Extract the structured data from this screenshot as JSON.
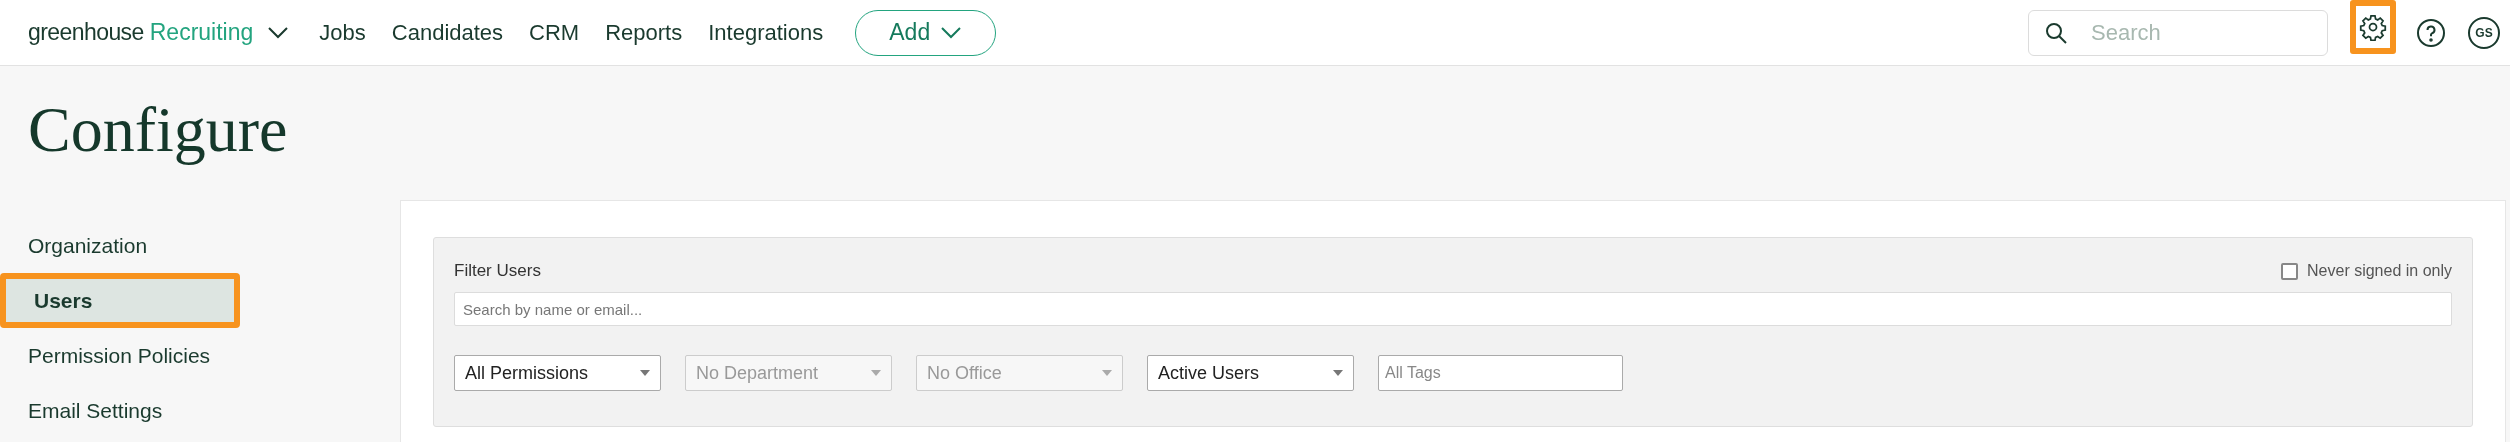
{
  "top_bar": {
    "logo": {
      "wordmark": "greenhouse",
      "product": "Recruiting"
    },
    "nav": [
      "Jobs",
      "Candidates",
      "CRM",
      "Reports",
      "Integrations"
    ],
    "add_button": "Add",
    "search": {
      "placeholder": "Search"
    },
    "settings": {
      "highlighted": true
    },
    "avatar": "GS"
  },
  "page_title": "Configure",
  "sidebar": {
    "items": [
      {
        "label": "Organization",
        "selected": false,
        "highlighted": false
      },
      {
        "label": "Users",
        "selected": true,
        "highlighted": true
      },
      {
        "label": "Permission Policies",
        "selected": false,
        "highlighted": false
      },
      {
        "label": "Email Settings",
        "selected": false,
        "highlighted": false
      }
    ]
  },
  "filter": {
    "title": "Filter Users",
    "never_signed_in": {
      "label": "Never signed in only",
      "checked": false
    },
    "search": {
      "placeholder": "Search by name or email..."
    },
    "controls": [
      {
        "kind": "select",
        "value": "All Permissions",
        "disabled": false
      },
      {
        "kind": "select",
        "value": "No Department",
        "disabled": true
      },
      {
        "kind": "select",
        "value": "No Office",
        "disabled": true
      },
      {
        "kind": "select",
        "value": "Active Users",
        "disabled": false
      },
      {
        "kind": "text",
        "placeholder": "All Tags"
      }
    ]
  }
}
